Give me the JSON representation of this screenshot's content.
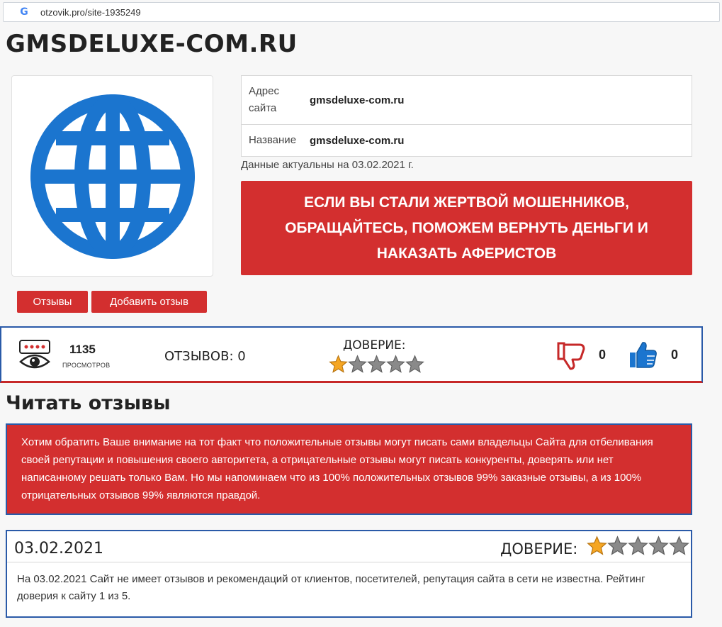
{
  "browser": {
    "url": "otzovik.pro/site-1935249",
    "search_engine_icon": "google-icon"
  },
  "site": {
    "title": "GMSDELUXE-COM.RU",
    "logo_icon": "globe-icon"
  },
  "buttons": {
    "reviews": "Отзывы",
    "add_review": "Добавить отзыв"
  },
  "info": {
    "rows": [
      {
        "label": "Адрес сайта",
        "value": "gmsdeluxe-com.ru"
      },
      {
        "label": "Название",
        "value": "gmsdeluxe-com.ru"
      }
    ],
    "actual_date": "Данные актуальны на 03.02.2021 г."
  },
  "banner": {
    "lines": [
      "ЕСЛИ ВЫ СТАЛИ ЖЕРТВОЙ МОШЕННИКОВ,",
      "ОБРАЩАЙТЕСЬ, ПОМОЖЕМ ВЕРНУТЬ ДЕНЬГИ И",
      "НАКАЗАТЬ АФЕРИСТОВ"
    ]
  },
  "stats": {
    "views_count": "1135",
    "views_label": "ПРОСМОТРОВ",
    "reviews_count": "ОТЗЫВОВ: 0",
    "trust_label": "ДОВЕРИЕ:",
    "trust_rating": 1,
    "trust_max": 5,
    "dislikes": "0",
    "likes": "0"
  },
  "colors": {
    "accent_red": "#d32f2f",
    "border_blue": "#2a5aa8",
    "star_gold": "#f5a623",
    "star_grey": "#8a8a8a"
  },
  "read_reviews": {
    "title": "Читать отзывы",
    "notice": "Хотим обратить Ваше внимание на тот факт что положительные отзывы могут писать сами владельцы Сайта для отбеливания своей репутации и повышения своего авторитета, а отрицательные отзывы могут писать конкуренты, доверять или нет написанному решать только Вам. Но мы напоминаем что из 100% положительных отзывов 99% заказные отзывы, а из 100% отрицательных отзывов 99% являются правдой."
  },
  "review": {
    "date": "03.02.2021",
    "trust_label": "ДОВЕРИЕ:",
    "rating": 1,
    "text": "На 03.02.2021 Сайт не имеет отзывов и рекомендаций от клиентов, посетителей, репутация сайта в сети не известна. Рейтинг доверия к сайту 1 из 5."
  }
}
